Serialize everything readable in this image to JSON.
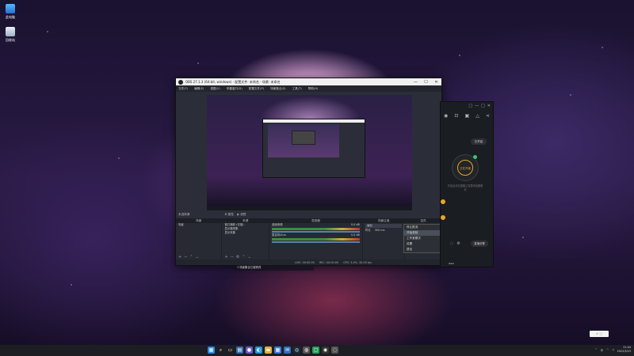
{
  "desktop": {
    "icons": [
      {
        "label": "此电脑",
        "glyph": "computer-icon"
      },
      {
        "label": "回收站",
        "glyph": "recycle-bin-icon"
      }
    ]
  },
  "obs": {
    "title": "OBS 27.1.3 (64-bit, windows) - 配置文件: 未命名 - 场景: 未命名",
    "title_controls": [
      "—",
      "☐",
      "✕"
    ],
    "menu": [
      "文件(F)",
      "编辑(E)",
      "视图(V)",
      "停靠窗口(D)",
      "配置文件(P)",
      "场景集合(S)",
      "工具(T)",
      "帮助(H)"
    ],
    "toolbar": {
      "label": "未选择源",
      "properties": "属性",
      "filters": "滤镜"
    },
    "docks": {
      "scenes": {
        "title": "场景",
        "items": [
          "场景"
        ]
      },
      "sources": {
        "title": "来源",
        "items": [
          "窗口捕获 (仅窗)",
          "显示器采集",
          "显示采集"
        ]
      },
      "mixer": {
        "title": "混音器",
        "channels": [
          {
            "name": "桌面音频",
            "level": "0.0 dB"
          },
          {
            "name": "麦克风/Aux",
            "level": "0.0 dB"
          }
        ]
      },
      "transitions": {
        "title": "场景过渡",
        "type": "淡出",
        "duration_label": "时长",
        "duration": "300 ms"
      },
      "controls": {
        "title": "控件",
        "buttons": [
          "停止推流",
          "开始录制",
          "工作室模式",
          "设置",
          "退出"
        ]
      }
    },
    "status": {
      "live": "LIVE: 00:00:00",
      "rec": "REC: 00:00:00",
      "cpu": "CPU: 3.4%, 30.00 fps"
    }
  },
  "context_menu": {
    "items": [
      "停止推流",
      "开始录制",
      "工作室模式",
      "设置",
      "退出"
    ],
    "highlighted": 1
  },
  "side_app": {
    "top_controls": [
      "□",
      "—",
      "□",
      "✕"
    ],
    "status_pill": "已开启",
    "start_label": "正在开播",
    "hint": "开启后请在直播工具里添加摄像头",
    "settings_pill": "直播设置",
    "accent": "#e7a52e"
  },
  "notification": "1 场景集合已被修改",
  "taskbar": {
    "apps": [
      "windows-start-icon",
      "search-icon",
      "task-view-icon",
      "widgets-icon",
      "chat-icon",
      "edge-icon",
      "explorer-icon",
      "store-icon",
      "mail-icon",
      "steam-icon",
      "app-icon",
      "app-icon",
      "obs-icon",
      "app-icon"
    ],
    "tray": {
      "ime": "中",
      "time": "21:44",
      "date": "2022/3/23"
    }
  },
  "popup": "✓ ◌"
}
